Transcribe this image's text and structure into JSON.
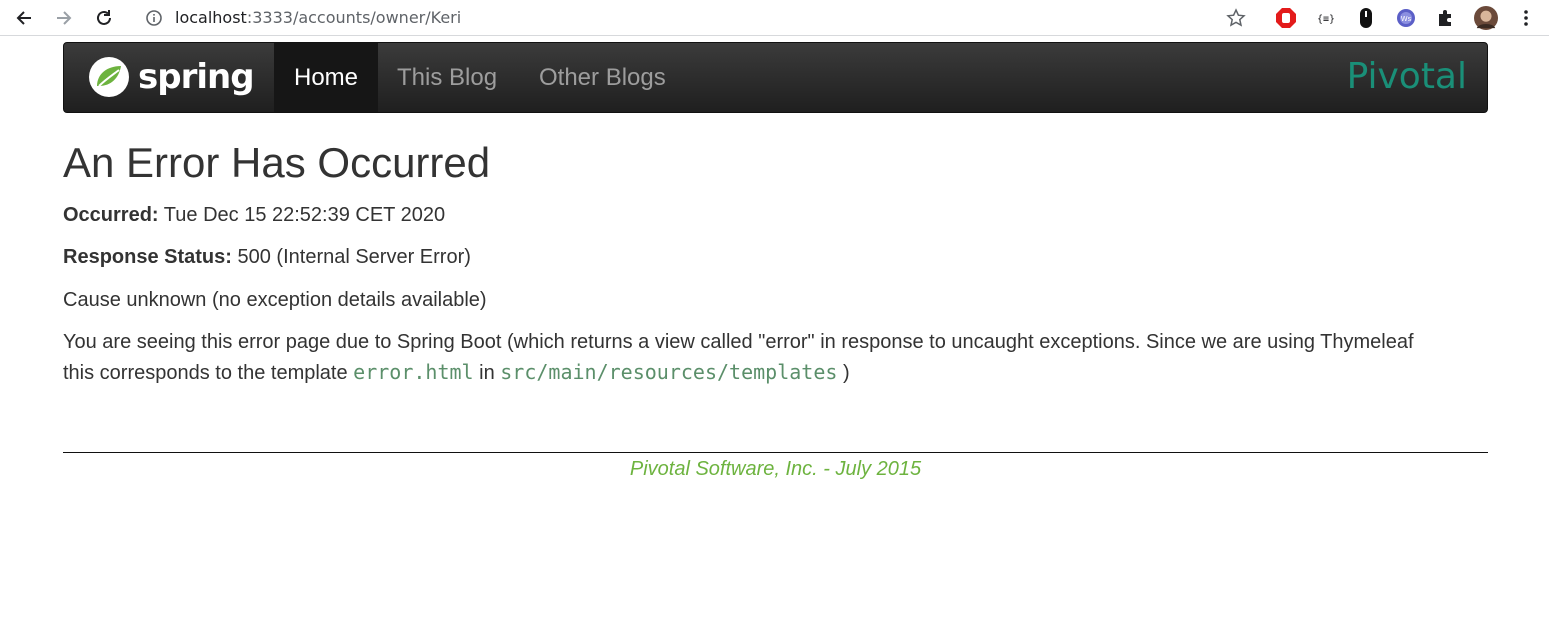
{
  "browser": {
    "url_host": "localhost",
    "url_path": ":3333/accounts/owner/Keri"
  },
  "navbar": {
    "brand": "spring",
    "items": [
      {
        "label": "Home",
        "active": true
      },
      {
        "label": "This Blog",
        "active": false
      },
      {
        "label": "Other Blogs",
        "active": false
      }
    ],
    "partner_logo": "Pivotal"
  },
  "content": {
    "title": "An Error Has Occurred",
    "occurred_label": "Occurred:",
    "occurred_value": " Tue Dec 15 22:52:39 CET 2020",
    "status_label": "Response Status:",
    "status_value": " 500 (Internal Server Error)",
    "cause": "Cause unknown (no exception details available)",
    "explanation_part1": "You are seeing this error page due to Spring Boot (which returns a view called \"error\" in response to uncaught exceptions. Since we are using Thymeleaf this corresponds to the template ",
    "explanation_code1": "error.html",
    "explanation_part2": " in ",
    "explanation_code2": "src/main/resources/templates",
    "explanation_part3": " )"
  },
  "footer": {
    "text": "Pivotal Software, Inc. - July 2015"
  },
  "colors": {
    "spring_green": "#6db33f",
    "pivotal_teal": "#1a8f78",
    "code_green": "#5b8f6a",
    "navbar_dark": "#222222"
  }
}
